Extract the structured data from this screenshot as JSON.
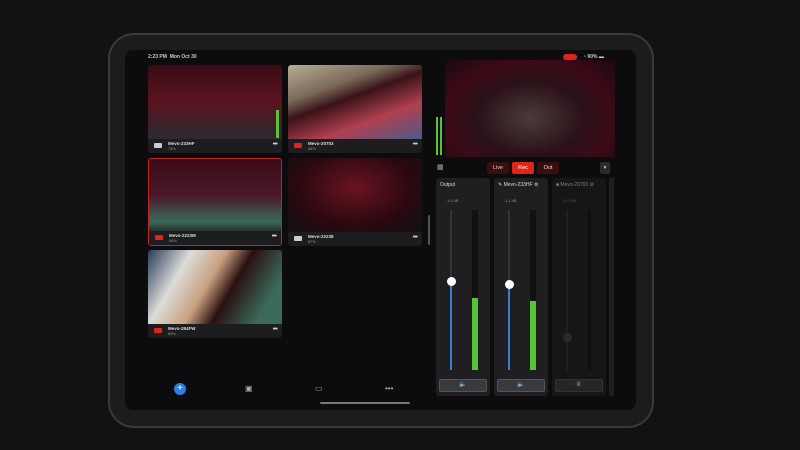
{
  "status": {
    "time": "2:23 PM",
    "date": "Mon Oct 30",
    "battery": "90%",
    "record_indicator": "REC"
  },
  "cameras": [
    {
      "name": "Mevo-233HF",
      "battery": "74%",
      "state": "idle",
      "icon": "camera-icon"
    },
    {
      "name": "Mevo-20703",
      "battery": "85%",
      "state": "live",
      "icon": "record-icon"
    },
    {
      "name": "Mevo-2223M",
      "battery": "84%",
      "state": "live",
      "selected": true,
      "icon": "record-icon"
    },
    {
      "name": "Mevo-22238",
      "battery": "87%",
      "state": "idle",
      "icon": "camera-icon"
    },
    {
      "name": "Mevo-284FW",
      "battery": "84%",
      "state": "live",
      "icon": "record-icon"
    }
  ],
  "controls": {
    "live": "Live",
    "rec": "Rec",
    "out": "Out"
  },
  "mixer": [
    {
      "name": "Output",
      "db": "-1.6 dB",
      "level": 0.55,
      "meter": 0.45,
      "muted": false
    },
    {
      "name": "Mevo-233HF",
      "db": "-1.1 dB",
      "level": 0.53,
      "meter": 0.43,
      "muted": false
    },
    {
      "name": "Mevo-20703",
      "db": "-10.5 dB",
      "level": 0.2,
      "meter": 0,
      "muted": true
    }
  ],
  "toolbar": {
    "more": "•••"
  },
  "colors": {
    "accent_red": "#e0241b",
    "slider_blue": "#3a7bd5",
    "meter_green": "#5bc236"
  }
}
